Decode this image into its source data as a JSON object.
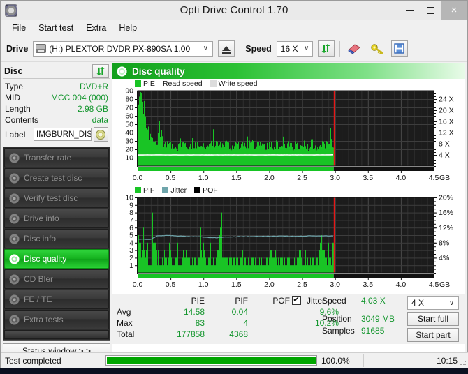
{
  "window": {
    "title": "Opti Drive Control 1.70",
    "icon": "disc-icon",
    "minimize": "—",
    "maximize": "□",
    "close": "×"
  },
  "menu": {
    "items": [
      "File",
      "Start test",
      "Extra",
      "Help"
    ]
  },
  "toolbar": {
    "drive_label": "Drive",
    "drive_value": "(H:)  PLEXTOR DVDR   PX-890SA 1.00",
    "eject_icon": "eject-icon",
    "speed_label": "Speed",
    "speed_value": "16 X",
    "refresh_icon": "refresh-icon",
    "eraser_icon": "eraser-icon",
    "key_icon": "key-icon",
    "save_icon": "save-icon",
    "caret": "∨"
  },
  "disc": {
    "header": "Disc",
    "refresh_icon": "refresh-icon",
    "rows": [
      {
        "key": "Type",
        "value": "DVD+R"
      },
      {
        "key": "MID",
        "value": "MCC 004 (000)"
      },
      {
        "key": "Length",
        "value": "2.98 GB"
      },
      {
        "key": "Contents",
        "value": "data"
      }
    ],
    "label_key": "Label",
    "label_value": "IMGBURN_DIS",
    "label_button_icon": "cd-icon"
  },
  "sidebar": {
    "items": [
      {
        "label": "Transfer rate",
        "icon": "disc-icon",
        "active": false
      },
      {
        "label": "Create test disc",
        "icon": "disc-icon",
        "active": false
      },
      {
        "label": "Verify test disc",
        "icon": "disc-icon",
        "active": false
      },
      {
        "label": "Drive info",
        "icon": "disc-icon",
        "active": false
      },
      {
        "label": "Disc info",
        "icon": "disc-icon",
        "active": false
      },
      {
        "label": "Disc quality",
        "icon": "disc-icon",
        "active": true
      },
      {
        "label": "CD Bler",
        "icon": "disc-icon",
        "active": false
      },
      {
        "label": "FE / TE",
        "icon": "disc-icon",
        "active": false
      },
      {
        "label": "Extra tests",
        "icon": "disc-icon",
        "active": false
      }
    ],
    "status_window_button": "Status window > >"
  },
  "panel": {
    "title": "Disc quality",
    "icon": "disc-icon"
  },
  "chart_data": [
    {
      "type": "area",
      "title": "PIE / Read speed",
      "xlabel": "GB",
      "ylabel": "PIE",
      "y2label": "Speed",
      "xlim": [
        0.0,
        4.5
      ],
      "ylim": [
        0,
        90
      ],
      "y2lim": [
        0,
        27
      ],
      "xticks": [
        "0.0",
        "0.5",
        "1.0",
        "1.5",
        "2.0",
        "2.5",
        "3.0",
        "3.5",
        "4.0",
        "4.5"
      ],
      "xtick_values": [
        0.0,
        0.5,
        1.0,
        1.5,
        2.0,
        2.5,
        3.0,
        3.5,
        4.0,
        4.5
      ],
      "x_unit": "GB",
      "yticks": [
        "10",
        "20",
        "30",
        "40",
        "50",
        "60",
        "70",
        "80",
        "90"
      ],
      "ytick_values": [
        10,
        20,
        30,
        40,
        50,
        60,
        70,
        80,
        90
      ],
      "y2ticks": [
        "4 X",
        "8 X",
        "12 X",
        "16 X",
        "20 X",
        "24 X"
      ],
      "y2tick_values": [
        4,
        8,
        12,
        16,
        20,
        24
      ],
      "grid": true,
      "legend": [
        {
          "name": "PIE",
          "color": "#19c425",
          "swatch": true
        },
        {
          "name": "Read speed",
          "color": "#ffffff",
          "swatch": false
        },
        {
          "name": "Write speed",
          "color": "#d8d8d8",
          "swatch": true
        }
      ],
      "data_end_gb": 2.98,
      "series": [
        {
          "name": "PIE",
          "color": "#19c425",
          "x": [
            0.0,
            0.03,
            0.06,
            0.09,
            0.12,
            0.15,
            0.18,
            0.21,
            0.25,
            0.3,
            0.35,
            0.4,
            0.45,
            0.5,
            0.55,
            0.6,
            0.65,
            0.7,
            0.75,
            0.8,
            0.85,
            0.9,
            0.95,
            1.0,
            1.05,
            1.1,
            1.15,
            1.2,
            1.25,
            1.3,
            1.35,
            1.4,
            1.45,
            1.5,
            1.55,
            1.6,
            1.65,
            1.7,
            1.75,
            1.8,
            1.85,
            1.9,
            1.95,
            2.0,
            2.05,
            2.1,
            2.15,
            2.2,
            2.25,
            2.3,
            2.35,
            2.4,
            2.45,
            2.5,
            2.55,
            2.6,
            2.65,
            2.7,
            2.75,
            2.8,
            2.85,
            2.9,
            2.95,
            2.98
          ],
          "y": [
            62,
            83,
            78,
            70,
            52,
            45,
            33,
            30,
            28,
            26,
            41,
            27,
            25,
            24,
            26,
            23,
            25,
            27,
            24,
            23,
            26,
            24,
            27,
            25,
            23,
            26,
            25,
            28,
            24,
            25,
            27,
            24,
            23,
            26,
            25,
            24,
            27,
            25,
            28,
            24,
            26,
            25,
            23,
            27,
            24,
            26,
            25,
            24,
            23,
            25,
            22,
            24,
            23,
            22,
            21,
            23,
            21,
            24,
            22,
            26,
            25,
            30,
            27,
            25
          ]
        },
        {
          "name": "Read speed",
          "color": "#ffffff",
          "x": [
            0.0,
            0.3,
            0.6,
            0.9,
            1.2,
            1.5,
            1.8,
            2.1,
            2.4,
            2.7,
            2.98
          ],
          "y_speed": [
            4.0,
            4.0,
            4.0,
            4.0,
            4.0,
            4.0,
            4.0,
            4.0,
            4.0,
            4.0,
            4.03
          ]
        }
      ]
    },
    {
      "type": "area",
      "title": "PIF / Jitter / POF",
      "xlabel": "GB",
      "ylabel": "PIF",
      "y2label": "Jitter",
      "xlim": [
        0.0,
        4.5
      ],
      "ylim": [
        0,
        10
      ],
      "y2lim": [
        0,
        20
      ],
      "xticks": [
        "0.0",
        "0.5",
        "1.0",
        "1.5",
        "2.0",
        "2.5",
        "3.0",
        "3.5",
        "4.0",
        "4.5"
      ],
      "xtick_values": [
        0.0,
        0.5,
        1.0,
        1.5,
        2.0,
        2.5,
        3.0,
        3.5,
        4.0,
        4.5
      ],
      "x_unit": "GB",
      "yticks": [
        "1",
        "2",
        "3",
        "4",
        "5",
        "6",
        "7",
        "8",
        "9",
        "10"
      ],
      "ytick_values": [
        1,
        2,
        3,
        4,
        5,
        6,
        7,
        8,
        9,
        10
      ],
      "y2ticks": [
        "4%",
        "8%",
        "12%",
        "16%",
        "20%"
      ],
      "y2tick_values": [
        4,
        8,
        12,
        16,
        20
      ],
      "grid": true,
      "legend": [
        {
          "name": "PIF",
          "color": "#19c425",
          "swatch": true
        },
        {
          "name": "Jitter",
          "color": "#6fa5ab",
          "swatch": true
        },
        {
          "name": "POF",
          "color": "#000000",
          "swatch": true
        }
      ],
      "data_end_gb": 2.98,
      "series": [
        {
          "name": "PIF",
          "color": "#19c425",
          "x": [
            0.0,
            0.05,
            0.1,
            0.15,
            0.2,
            0.25,
            0.3,
            0.35,
            0.4,
            0.45,
            0.5,
            0.55,
            0.6,
            0.65,
            0.7,
            0.75,
            0.8,
            0.85,
            0.9,
            0.95,
            1.0,
            1.05,
            1.1,
            1.15,
            1.2,
            1.25,
            1.3,
            1.35,
            1.4,
            1.45,
            1.5,
            1.55,
            1.6,
            1.65,
            1.7,
            1.75,
            1.8,
            1.85,
            1.9,
            1.95,
            2.0,
            2.05,
            2.1,
            2.15,
            2.2,
            2.25,
            2.3,
            2.35,
            2.4,
            2.45,
            2.5,
            2.55,
            2.6,
            2.65,
            2.7,
            2.75,
            2.8,
            2.85,
            2.9,
            2.95,
            2.98
          ],
          "y": [
            4,
            3,
            2,
            2,
            1,
            4,
            2,
            1,
            2,
            1,
            2,
            1,
            2,
            1,
            3,
            2,
            1,
            2,
            1,
            2,
            3,
            1,
            2,
            1,
            2,
            4,
            2,
            1,
            2,
            1,
            2,
            1,
            3,
            2,
            1,
            2,
            1,
            2,
            1,
            2,
            1,
            3,
            2,
            1,
            2,
            1,
            2,
            1,
            2,
            3,
            1,
            2,
            1,
            2,
            1,
            2,
            4,
            2,
            1,
            2,
            3
          ]
        },
        {
          "name": "Jitter",
          "color": "#6fa5ab",
          "x": [
            0.0,
            0.1,
            0.2,
            0.3,
            0.4,
            0.5,
            0.6,
            0.7,
            0.8,
            0.9,
            1.0,
            1.1,
            1.2,
            1.3,
            1.4,
            1.5,
            1.6,
            1.7,
            1.8,
            1.9,
            2.0,
            2.1,
            2.2,
            2.3,
            2.4,
            2.5,
            2.6,
            2.7,
            2.8,
            2.9,
            2.98
          ],
          "y_jitter": [
            9.0,
            8.9,
            8.9,
            9.8,
            9.9,
            9.9,
            9.8,
            9.7,
            9.6,
            9.6,
            9.5,
            9.4,
            9.3,
            9.5,
            9.5,
            9.6,
            9.6,
            9.6,
            9.7,
            9.7,
            9.7,
            9.7,
            9.8,
            9.7,
            9.7,
            9.7,
            9.8,
            9.8,
            9.8,
            9.8,
            9.8
          ]
        },
        {
          "name": "POF",
          "color": "#000000",
          "x": [],
          "y": []
        }
      ]
    }
  ],
  "results": {
    "columns": [
      "PIE",
      "PIF",
      "POF",
      "Jitter"
    ],
    "jitter_checkbox_checked": true,
    "jitter_checkbox_glyph": "✔",
    "rows": [
      {
        "name": "Avg",
        "pie": "14.58",
        "pif": "0.04",
        "pof": "",
        "jitter": "9.6%"
      },
      {
        "name": "Max",
        "pie": "83",
        "pif": "4",
        "pof": "",
        "jitter": "10.2%"
      },
      {
        "name": "Total",
        "pie": "177858",
        "pif": "4368",
        "pof": "",
        "jitter": ""
      }
    ],
    "speed_key": "Speed",
    "speed_value": "4.03 X",
    "position_key": "Position",
    "position_value": "3049 MB",
    "samples_key": "Samples",
    "samples_value": "91685",
    "speed_select_value": "4 X",
    "speed_select_caret": "∨",
    "start_full_button": "Start full",
    "start_part_button": "Start part"
  },
  "statusbar": {
    "text": "Test completed",
    "progress_percent": 100.0,
    "progress_label": "100.0%",
    "time": "10:15"
  }
}
